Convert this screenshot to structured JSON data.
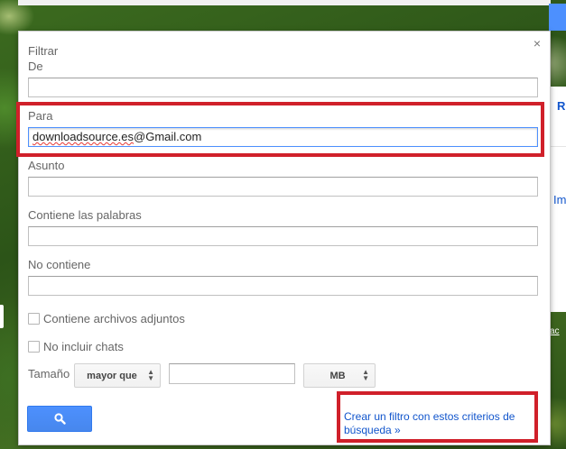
{
  "background": {
    "right_panel_r": "R",
    "right_panel_im": "Im",
    "right_panel_vac": "vac"
  },
  "dialog": {
    "close": "×",
    "title": "Filtrar",
    "fields": {
      "from_label": "De",
      "from_value": "",
      "to_label": "Para",
      "to_value_prefix": "downloadsource.es",
      "to_value_suffix": "@Gmail.com",
      "subject_label": "Asunto",
      "subject_value": "",
      "has_words_label": "Contiene las palabras",
      "has_words_value": "",
      "doesnt_have_label": "No contiene",
      "doesnt_have_value": ""
    },
    "checkboxes": {
      "has_attachment_label": "Contiene archivos adjuntos",
      "has_attachment_checked": false,
      "no_chats_label": "No incluir chats",
      "no_chats_checked": false
    },
    "size": {
      "label": "Tamaño",
      "comparison": "mayor que",
      "value": "",
      "unit": "MB"
    },
    "search_icon": "search-icon",
    "create_filter_link": "Crear un filtro con estos criterios de búsqueda »"
  },
  "colors": {
    "accent_blue": "#4d90fe",
    "link_blue": "#1155cc",
    "highlight_red": "#d0202a"
  }
}
